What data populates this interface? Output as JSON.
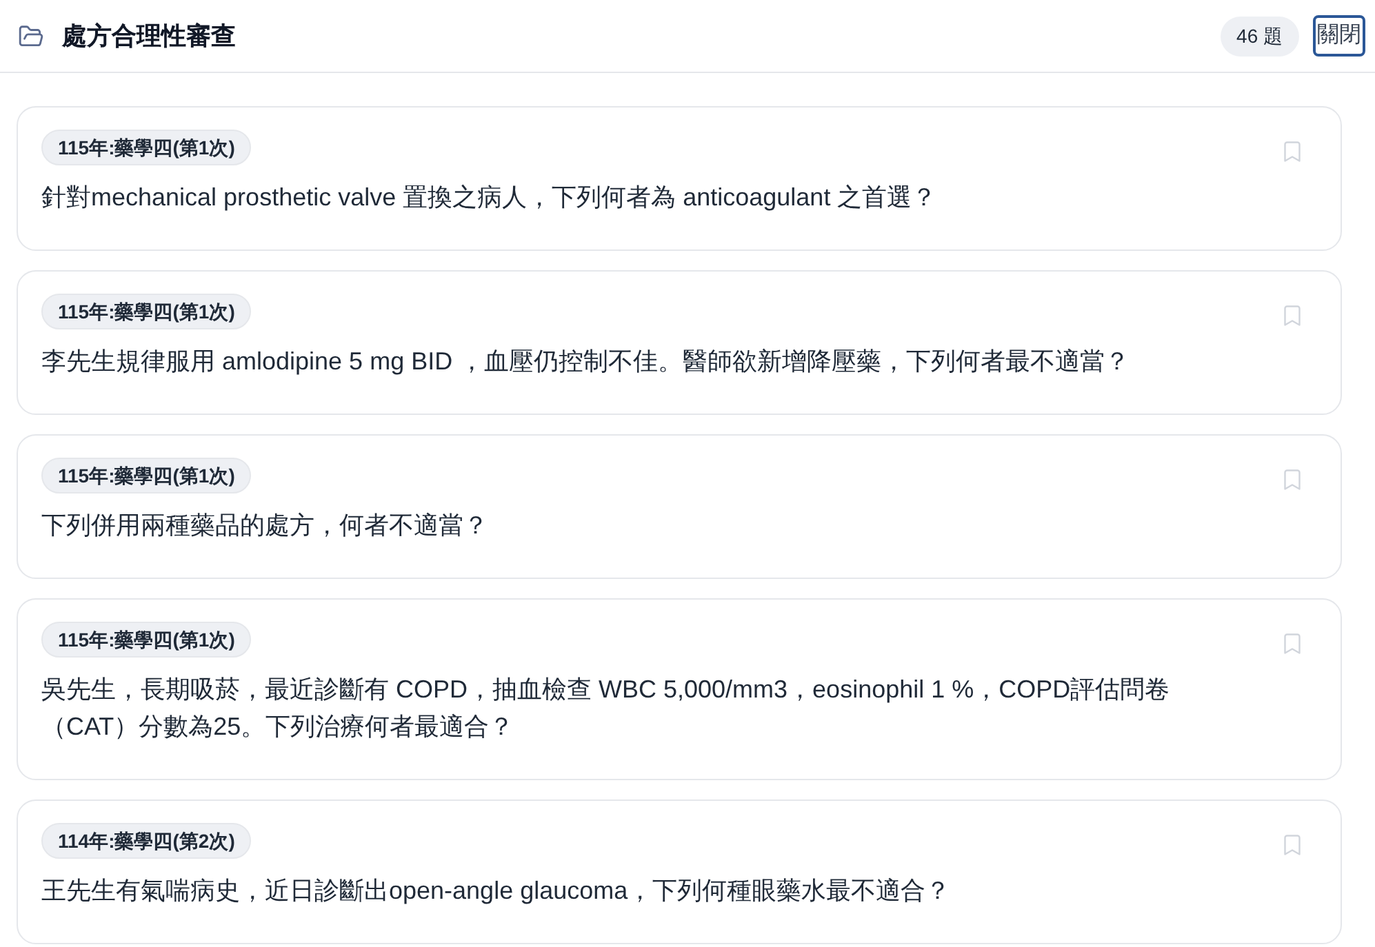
{
  "header": {
    "title": "處方合理性審查",
    "count": "46 題",
    "close_button": "關閉"
  },
  "questions": [
    {
      "tag": "115年:藥學四(第1次)",
      "text": "針對mechanical prosthetic valve 置換之病人，下列何者為 anticoagulant 之首選？",
      "bookmarked": false
    },
    {
      "tag": "115年:藥學四(第1次)",
      "text": "李先生規律服用 amlodipine 5 mg BID ，血壓仍控制不佳。醫師欲新增降壓藥，下列何者最不適當？",
      "bookmarked": false
    },
    {
      "tag": "115年:藥學四(第1次)",
      "text": "下列併用兩種藥品的處方，何者不適當？",
      "bookmarked": false
    },
    {
      "tag": "115年:藥學四(第1次)",
      "text": "吳先生，長期吸菸，最近診斷有 COPD，抽血檢查 WBC 5,000/mm3，eosinophil 1 %，COPD評估問卷（CAT）分數為25。下列治療何者最適合？",
      "bookmarked": false
    },
    {
      "tag": "114年:藥學四(第2次)",
      "text": "王先生有氣喘病史，近日診斷出open-angle glaucoma，下列何種眼藥水最不適合？",
      "bookmarked": false
    }
  ]
}
